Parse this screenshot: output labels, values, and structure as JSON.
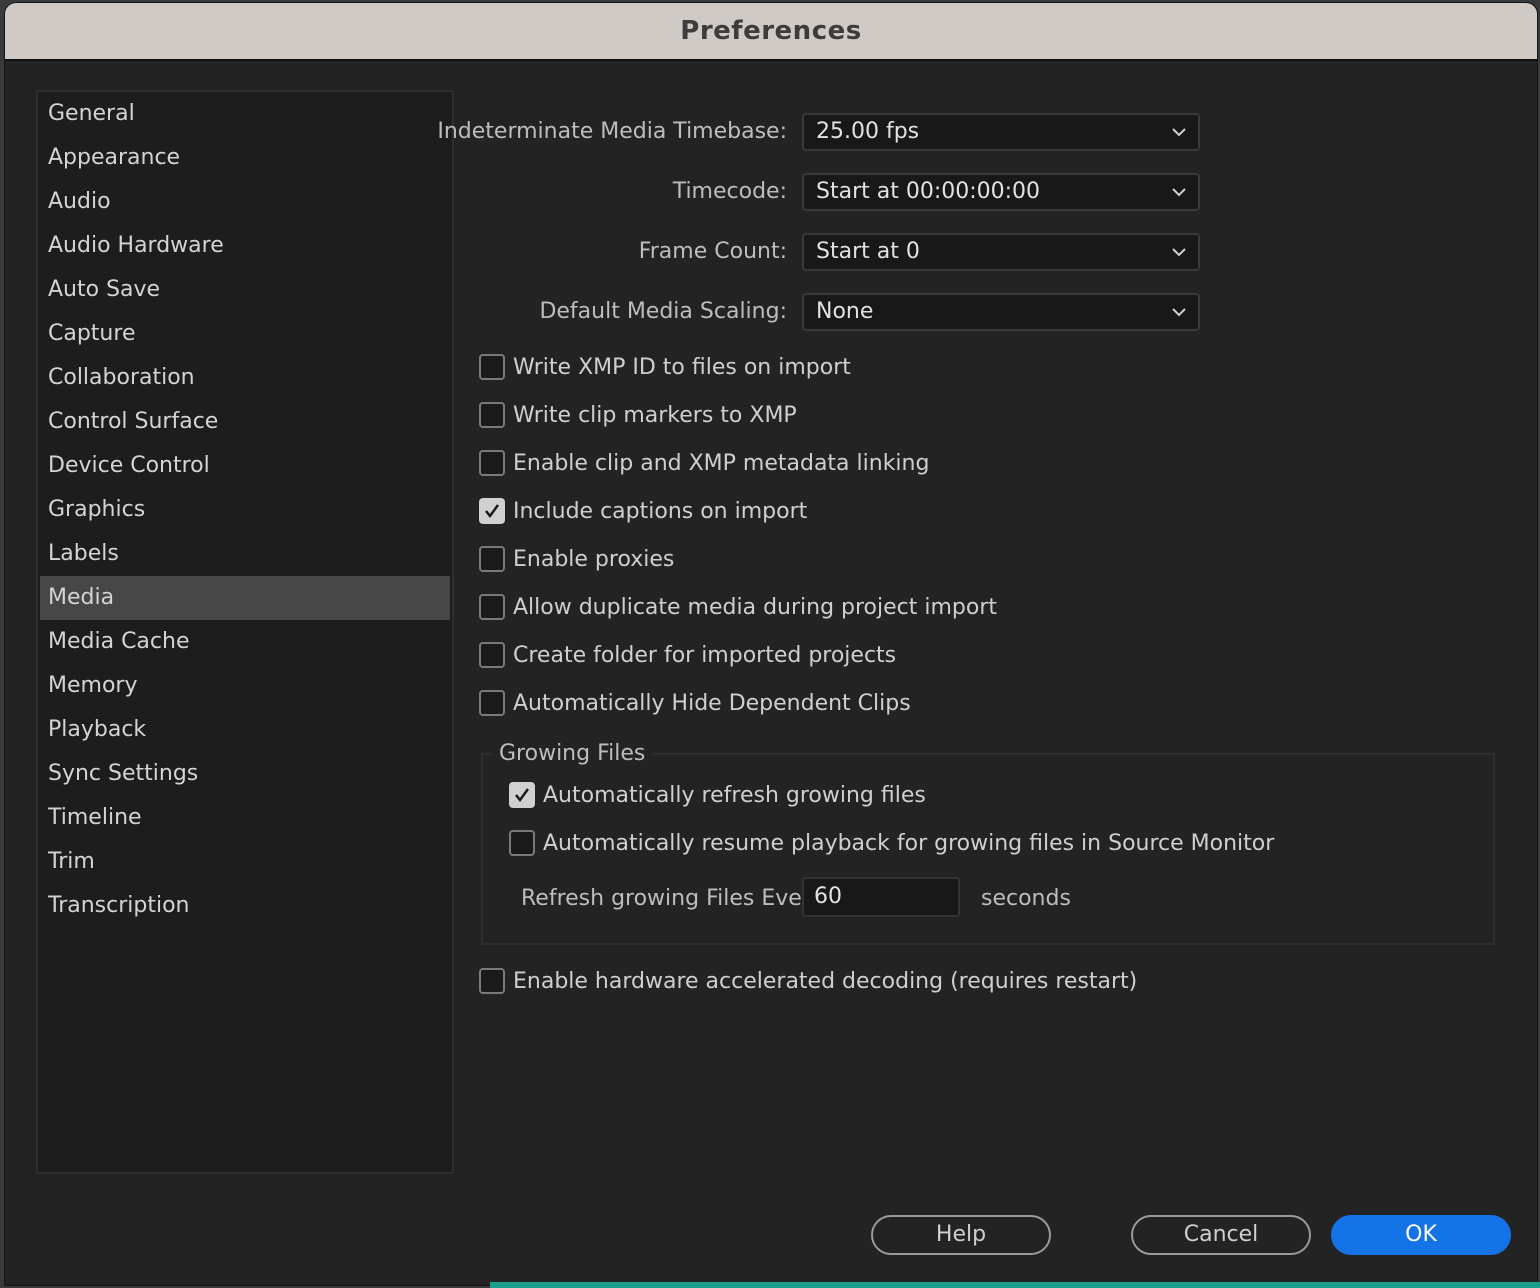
{
  "window": {
    "title": "Preferences"
  },
  "sidebar": {
    "items": [
      {
        "label": "General"
      },
      {
        "label": "Appearance"
      },
      {
        "label": "Audio"
      },
      {
        "label": "Audio Hardware"
      },
      {
        "label": "Auto Save"
      },
      {
        "label": "Capture"
      },
      {
        "label": "Collaboration"
      },
      {
        "label": "Control Surface"
      },
      {
        "label": "Device Control"
      },
      {
        "label": "Graphics"
      },
      {
        "label": "Labels"
      },
      {
        "label": "Media"
      },
      {
        "label": "Media Cache"
      },
      {
        "label": "Memory"
      },
      {
        "label": "Playback"
      },
      {
        "label": "Sync Settings"
      },
      {
        "label": "Timeline"
      },
      {
        "label": "Trim"
      },
      {
        "label": "Transcription"
      }
    ],
    "selected": "Media"
  },
  "fields": {
    "timebase": {
      "label": "Indeterminate Media Timebase:",
      "value": "25.00 fps"
    },
    "timecode": {
      "label": "Timecode:",
      "value": "Start at 00:00:00:00"
    },
    "frame_count": {
      "label": "Frame Count:",
      "value": "Start at 0"
    },
    "scaling": {
      "label": "Default Media Scaling:",
      "value": "None"
    }
  },
  "checkboxes": [
    {
      "label": "Write XMP ID to files on import",
      "checked": false
    },
    {
      "label": "Write clip markers to XMP",
      "checked": false
    },
    {
      "label": "Enable clip and XMP metadata linking",
      "checked": false
    },
    {
      "label": "Include captions on import",
      "checked": true
    },
    {
      "label": "Enable proxies",
      "checked": false
    },
    {
      "label": "Allow duplicate media during project import",
      "checked": false
    },
    {
      "label": "Create folder for imported projects",
      "checked": false
    },
    {
      "label": "Automatically Hide Dependent Clips",
      "checked": false
    }
  ],
  "growing_files": {
    "title": "Growing Files",
    "checkboxes": [
      {
        "label": "Automatically refresh growing files",
        "checked": true
      },
      {
        "label": "Automatically resume playback for growing files in Source Monitor",
        "checked": false
      }
    ],
    "refresh_label": "Refresh growing Files Every",
    "refresh_value": "60",
    "refresh_unit": "seconds"
  },
  "hardware_decoding": {
    "label": "Enable hardware accelerated decoding (requires restart)",
    "checked": false
  },
  "buttons": {
    "help": "Help",
    "cancel": "Cancel",
    "ok": "OK"
  },
  "colors": {
    "accent": "#1473e6",
    "selected_item": "#474747"
  }
}
